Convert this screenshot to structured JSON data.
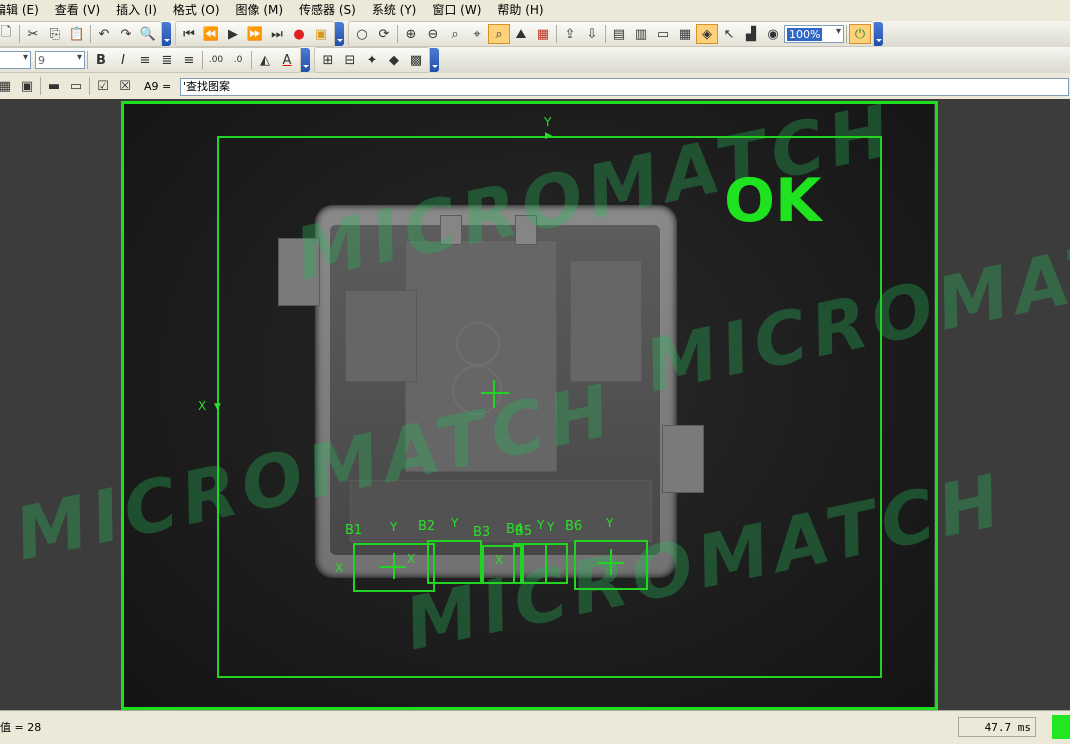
{
  "menu": [
    "编辑(E)",
    "查看(V)",
    "插入(I)",
    "格式(O)",
    "图像(M)",
    "传感器(S)",
    "系统(Y)",
    "窗口(W)",
    "帮助(H)"
  ],
  "menu_display": [
    "编辑 (E)",
    "查看 (V)",
    "插入 (I)",
    "格式 (O)",
    "图像 (M)",
    "传感器 (S)",
    "系统 (Y)",
    "窗口 (W)",
    "帮助 (H)"
  ],
  "toolbar": {
    "zoom_value": "100%",
    "font_size": "9"
  },
  "formula_bar": {
    "cell_ref": "A9 =",
    "content": "'查找图案"
  },
  "image": {
    "result": "OK",
    "watermark": "MICROMATCH",
    "axis_y": "Y",
    "axis_x": "X",
    "roi_labels": [
      "B1",
      "B2",
      "B3",
      "B4",
      "B5",
      "B6"
    ]
  },
  "status": {
    "left_text": "值 = 28",
    "time": "47.7 ms"
  },
  "colors": {
    "overlay_green": "#22d322",
    "ok_green": "#1ee31e",
    "ui_bg": "#ece9d8"
  }
}
